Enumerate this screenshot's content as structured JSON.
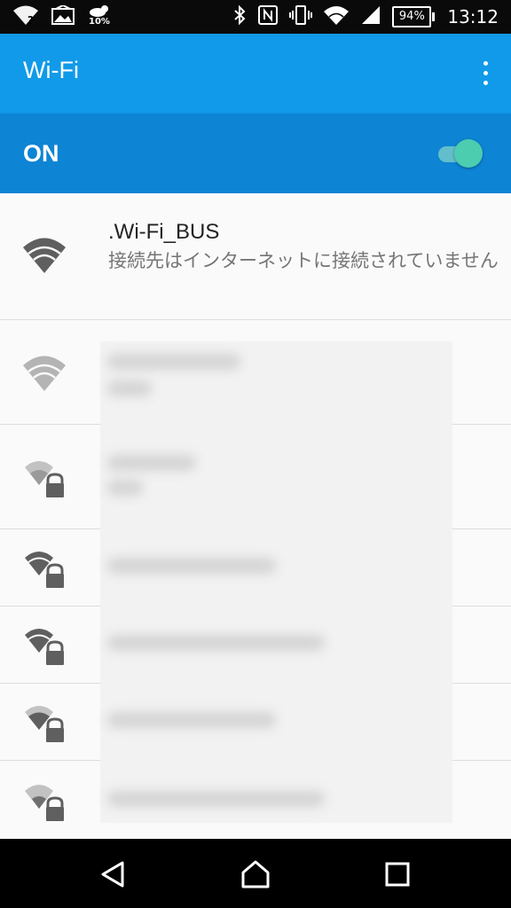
{
  "status_bar": {
    "time": "13:12",
    "battery": "94%",
    "weather_percent": "10%",
    "icons": [
      "wifi-unknown-icon",
      "gallery-icon",
      "weather-icon",
      "bluetooth-icon",
      "nfc-icon",
      "vibrate-icon",
      "wifi-signal-icon",
      "cell-signal-icon",
      "battery-icon"
    ]
  },
  "app_bar": {
    "title": "Wi-Fi",
    "overflow_icon": "more-vert-icon"
  },
  "master_switch": {
    "label": "ON",
    "checked": true,
    "color": "#4ccdb0"
  },
  "connected_network": {
    "ssid": ".Wi-Fi_BUS",
    "summary": "接続先はインターネットに接続されていません",
    "icon": "wifi-full-icon"
  },
  "other_networks": [
    {
      "icon": "wifi-open-icon",
      "secured": false,
      "strength": 3
    },
    {
      "icon": "wifi-lock-icon",
      "secured": true,
      "strength": 1
    },
    {
      "icon": "wifi-lock-icon",
      "secured": true,
      "strength": 3
    },
    {
      "icon": "wifi-lock-icon",
      "secured": true,
      "strength": 3
    },
    {
      "icon": "wifi-lock-icon",
      "secured": true,
      "strength": 2
    },
    {
      "icon": "wifi-lock-icon",
      "secured": true,
      "strength": 1
    }
  ],
  "nav_bar": {
    "icons": [
      "back-icon",
      "home-icon",
      "recents-icon"
    ]
  },
  "colors": {
    "app_bar": "#119ae9",
    "switch_bar": "#0d84d4",
    "status_bar": "#0a0a0a"
  }
}
